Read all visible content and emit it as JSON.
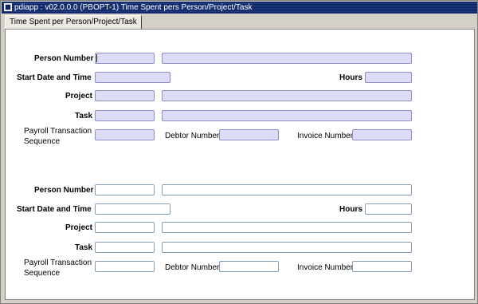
{
  "window": {
    "title": "pdiapp : v02.0.0.0  (PBOPT-1) Time Spent pers Person/Project/Task"
  },
  "tab": {
    "label": "Time Spent per Person/Project/Task"
  },
  "query_block": {
    "person_number_label": "Person Number",
    "start_date_label": "Start Date and Time",
    "hours_label": "Hours",
    "project_label": "Project",
    "task_label": "Task",
    "payroll_label_1": "Payroll Transaction",
    "payroll_label_2": "Sequence",
    "debtor_label": "Debtor Number",
    "invoice_label": "Invoice Number"
  },
  "detail_block": {
    "person_number_label": "Person Number",
    "start_date_label": "Start Date and Time",
    "hours_label": "Hours",
    "project_label": "Project",
    "task_label": "Task",
    "payroll_label_1": "Payroll Transaction",
    "payroll_label_2": "Sequence",
    "debtor_label": "Debtor Number",
    "invoice_label": "Invoice Number"
  },
  "colors": {
    "query_field_bg": "#dcdcf5",
    "titlebar": "#0a246a",
    "panel": "#ffffff"
  }
}
